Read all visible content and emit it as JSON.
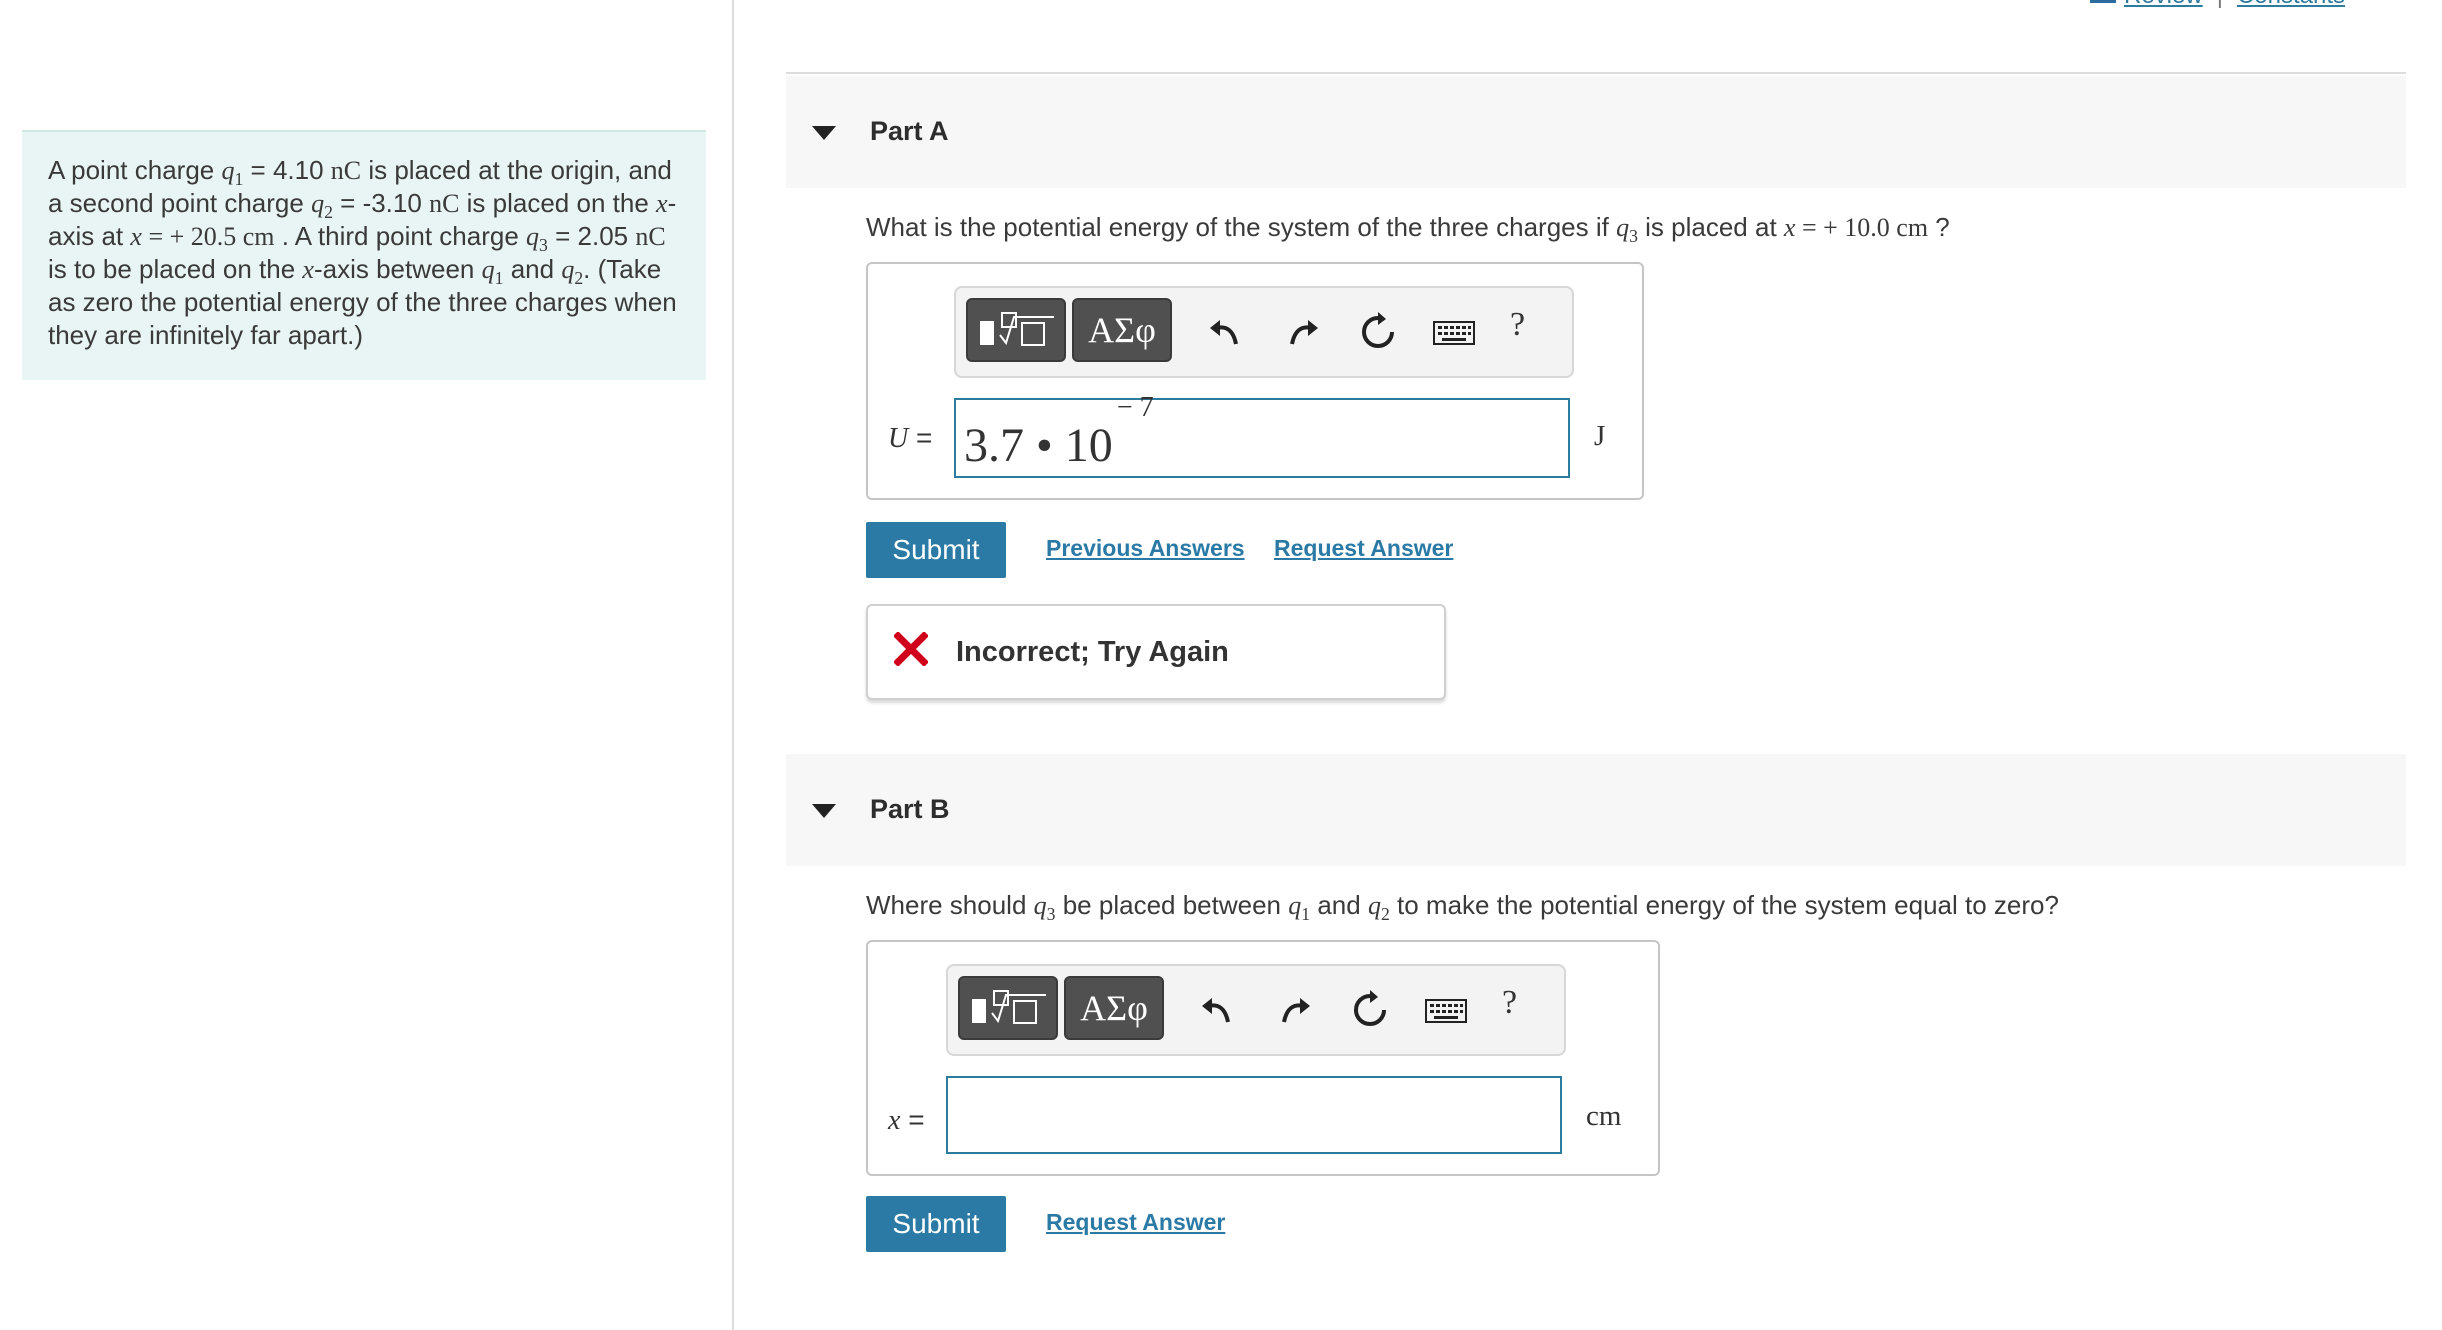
{
  "top_links": {
    "review": "Review",
    "constants": "Constants"
  },
  "problem": {
    "s1": "A point charge",
    "q1": "q",
    "q1_sub": "1",
    "s2": " = 4.10",
    "nC1": "nC",
    "s3": " is placed at the origin, and a second point charge",
    "q2": "q",
    "q2_sub": "2",
    "s4": " = -3.10",
    "nC2": "nC",
    "s5": " is placed on the",
    "x1": "x",
    "s6": "-axis at",
    "x2": "x",
    "s7": " = + 20.5",
    "cm": " cm",
    "s8": " . A third point charge",
    "q3": "q",
    "q3_sub": "3",
    "s9": " = 2.05",
    "nC3": "nC",
    "s10": " is to be placed on the",
    "x3": "x",
    "s11": "-axis between",
    "q1b": "q",
    "q1b_sub": "1",
    "s12": " and",
    "q2b": "q",
    "q2b_sub": "2",
    "s13": ". (Take as zero the potential energy of the three charges when they are infinitely far apart.)"
  },
  "partA": {
    "title": "Part A",
    "question_pre": "What is the potential energy of the system of the three charges if",
    "q": "q",
    "q_sub": "3",
    "question_mid": " is placed at",
    "x": "x",
    "question_val": " = + 10.0",
    "question_unit": " cm",
    "question_end": " ?",
    "var": "U",
    "eq": " =",
    "answer_mantissa": "3.7 • 10",
    "answer_exp": "− 7",
    "unit": "J",
    "submit": "Submit",
    "prev_answers": "Previous Answers",
    "request_answer": "Request Answer",
    "feedback": "Incorrect; Try Again",
    "greek": "ΑΣφ",
    "help": "?"
  },
  "partB": {
    "title": "Part B",
    "q_pre": "Where should",
    "q3": "q",
    "q3_sub": "3",
    "q_mid1": " be placed between",
    "q1": "q",
    "q1_sub": "1",
    "q_mid2": " and",
    "q2": "q",
    "q2_sub": "2",
    "q_end": " to make the potential energy of the system equal to zero?",
    "var": "x",
    "eq": " =",
    "answer_value": "",
    "unit": "cm",
    "submit": "Submit",
    "request_answer": "Request Answer",
    "greek": "ΑΣφ",
    "help": "?"
  },
  "colors": {
    "accent": "#2b7aa6",
    "panel": "#e9f5f4",
    "error": "#d0021b"
  }
}
